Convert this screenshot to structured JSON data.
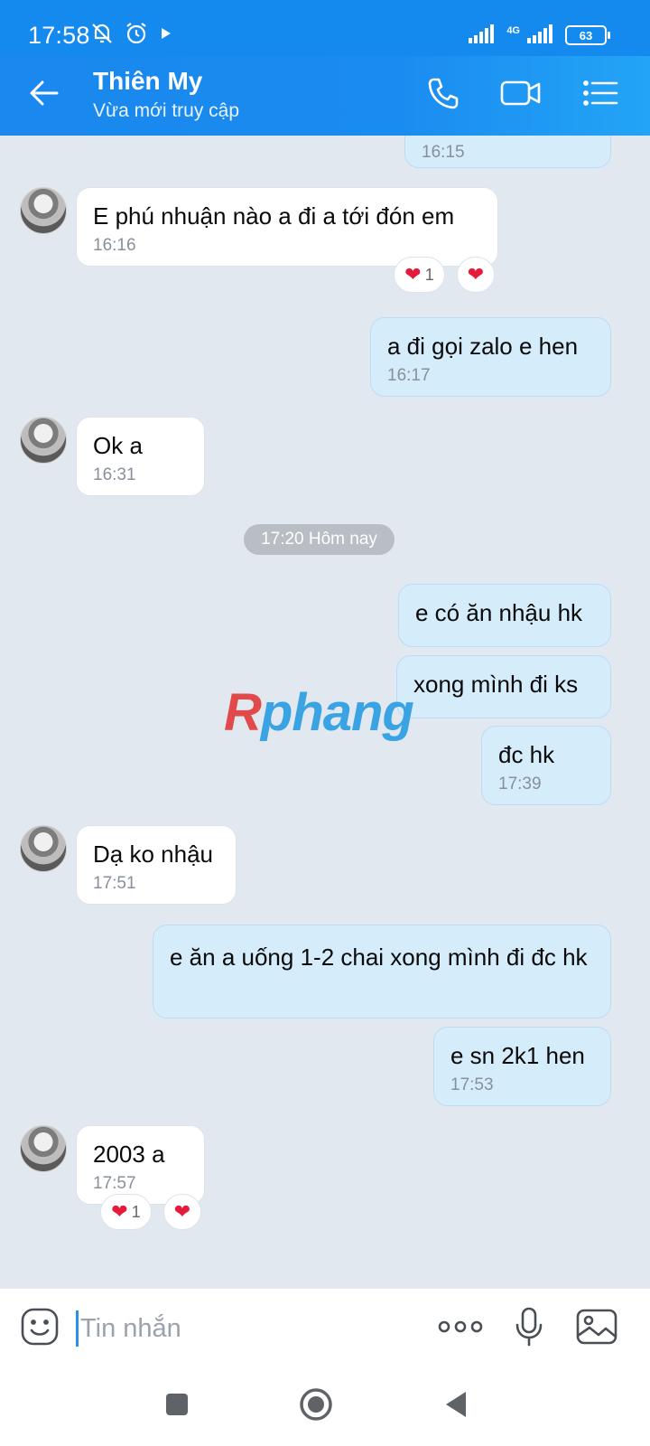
{
  "status_bar": {
    "time": "17:58",
    "network": "4G",
    "battery": "63",
    "icons": [
      "mute-icon",
      "alarm-icon",
      "play-icon",
      "signal-icon",
      "wifi-icon",
      "battery-icon"
    ]
  },
  "header": {
    "contact_name": "Thiên My",
    "contact_status": "Vừa mới truy cập",
    "icons": [
      "back-arrow-icon",
      "phone-icon",
      "video-icon",
      "menu-list-icon"
    ]
  },
  "messages": [
    {
      "id": "m0",
      "dir": "sent",
      "text": "",
      "time": "16:15"
    },
    {
      "id": "m1",
      "dir": "recv",
      "text": "E phú nhuận nào a đi a tới đón em",
      "time": "16:16",
      "reaction_count": "1"
    },
    {
      "id": "m2",
      "dir": "sent",
      "text": "a đi gọi zalo e hen",
      "time": "16:17"
    },
    {
      "id": "m3",
      "dir": "recv",
      "text": "Ok a",
      "time": "16:31"
    },
    {
      "id": "m4",
      "dir": "sent",
      "text": "e có ăn nhậu hk",
      "time": ""
    },
    {
      "id": "m5",
      "dir": "sent",
      "text": "xong mình đi ks",
      "time": ""
    },
    {
      "id": "m6",
      "dir": "sent",
      "text": "đc hk",
      "time": "17:39"
    },
    {
      "id": "m7",
      "dir": "recv",
      "text": "Dạ ko nhậu",
      "time": "17:51"
    },
    {
      "id": "m8",
      "dir": "sent",
      "text": "e ăn a uống 1-2 chai xong mình đi đc hk",
      "time": ""
    },
    {
      "id": "m9",
      "dir": "sent",
      "text": "e sn 2k1 hen",
      "time": "17:53"
    },
    {
      "id": "m10",
      "dir": "recv",
      "text": "2003 a",
      "time": "17:57",
      "reaction_count": "1"
    }
  ],
  "date_separator": "17:20 Hôm nay",
  "watermark": {
    "r": "R",
    "rest": "phang"
  },
  "input_bar": {
    "placeholder": "Tin nhắn",
    "icons": [
      "emoji-icon",
      "more-icon",
      "microphone-icon",
      "image-icon"
    ]
  },
  "nav_bar": {
    "icons": [
      "recent-apps-icon",
      "home-icon",
      "back-icon"
    ]
  },
  "colors": {
    "header": "#1a88ee",
    "sent_bubble": "#d5ecfb",
    "received_bubble": "#ffffff",
    "chat_bg": "#e2e8ef",
    "heart": "#e41c3a"
  }
}
